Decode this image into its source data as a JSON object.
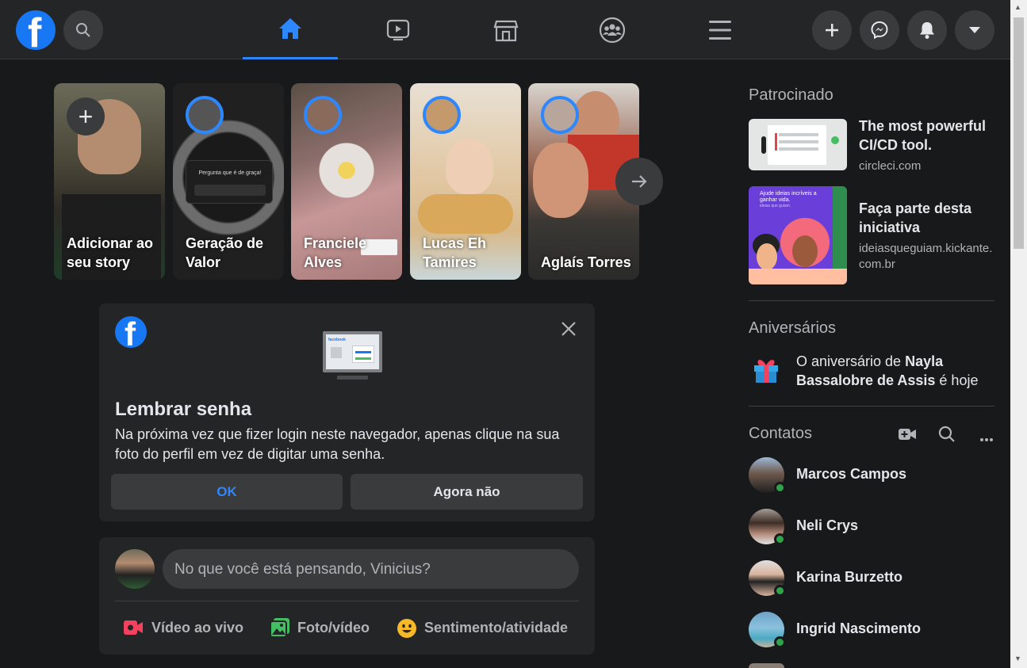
{
  "nav": {
    "logo_letter": "f",
    "tabs": [
      "home",
      "watch",
      "marketplace",
      "groups",
      "menu"
    ]
  },
  "stories": [
    {
      "name": "Adicionar ao seu story",
      "plus": "+"
    },
    {
      "name": "Geração de Valor",
      "card_text": "Pergunta que é de graça!"
    },
    {
      "name": "Franciele Alves"
    },
    {
      "name": "Lucas Eh Tamires"
    },
    {
      "name": "Aglaís Torres"
    }
  ],
  "password_prompt": {
    "title": "Lembrar senha",
    "body": "Na próxima vez que fizer login neste navegador, apenas clique na sua foto do perfil em vez de digitar uma senha.",
    "ok_label": "OK",
    "cancel_label": "Agora não",
    "illustration_label": "facebook"
  },
  "composer": {
    "placeholder": "No que você está pensando, Vinicius?",
    "actions": [
      {
        "label": "Vídeo ao vivo",
        "icon": "live-video-icon",
        "color": "#f3425f"
      },
      {
        "label": "Foto/vídeo",
        "icon": "photo-icon",
        "color": "#45bd62"
      },
      {
        "label": "Sentimento/atividade",
        "icon": "feeling-icon",
        "color": "#f7b928"
      }
    ]
  },
  "sidebar": {
    "sponsored_heading": "Patrocinado",
    "ads": [
      {
        "title": "The most powerful CI/CD tool.",
        "url": "circleci.com"
      },
      {
        "title": "Faça parte desta iniciativa",
        "url": "ideiasqueguiam.kickante.com.br",
        "image_text": "Ajude ideias incríveis a ganhar vida.",
        "image_subtext": "ideias que guiam."
      }
    ],
    "birthdays_heading": "Aniversários",
    "birthday": {
      "prefix": "O aniversário de ",
      "name": "Nayla Bassalobre de Assis",
      "suffix": " é hoje"
    },
    "contacts_heading": "Contatos",
    "contacts": [
      {
        "name": "Marcos Campos"
      },
      {
        "name": "Neli Crys"
      },
      {
        "name": "Karina Burzetto"
      },
      {
        "name": "Ingrid Nascimento"
      }
    ]
  },
  "colors": {
    "accent": "#2d88ff",
    "brand": "#1877f2",
    "online": "#31a24c"
  }
}
